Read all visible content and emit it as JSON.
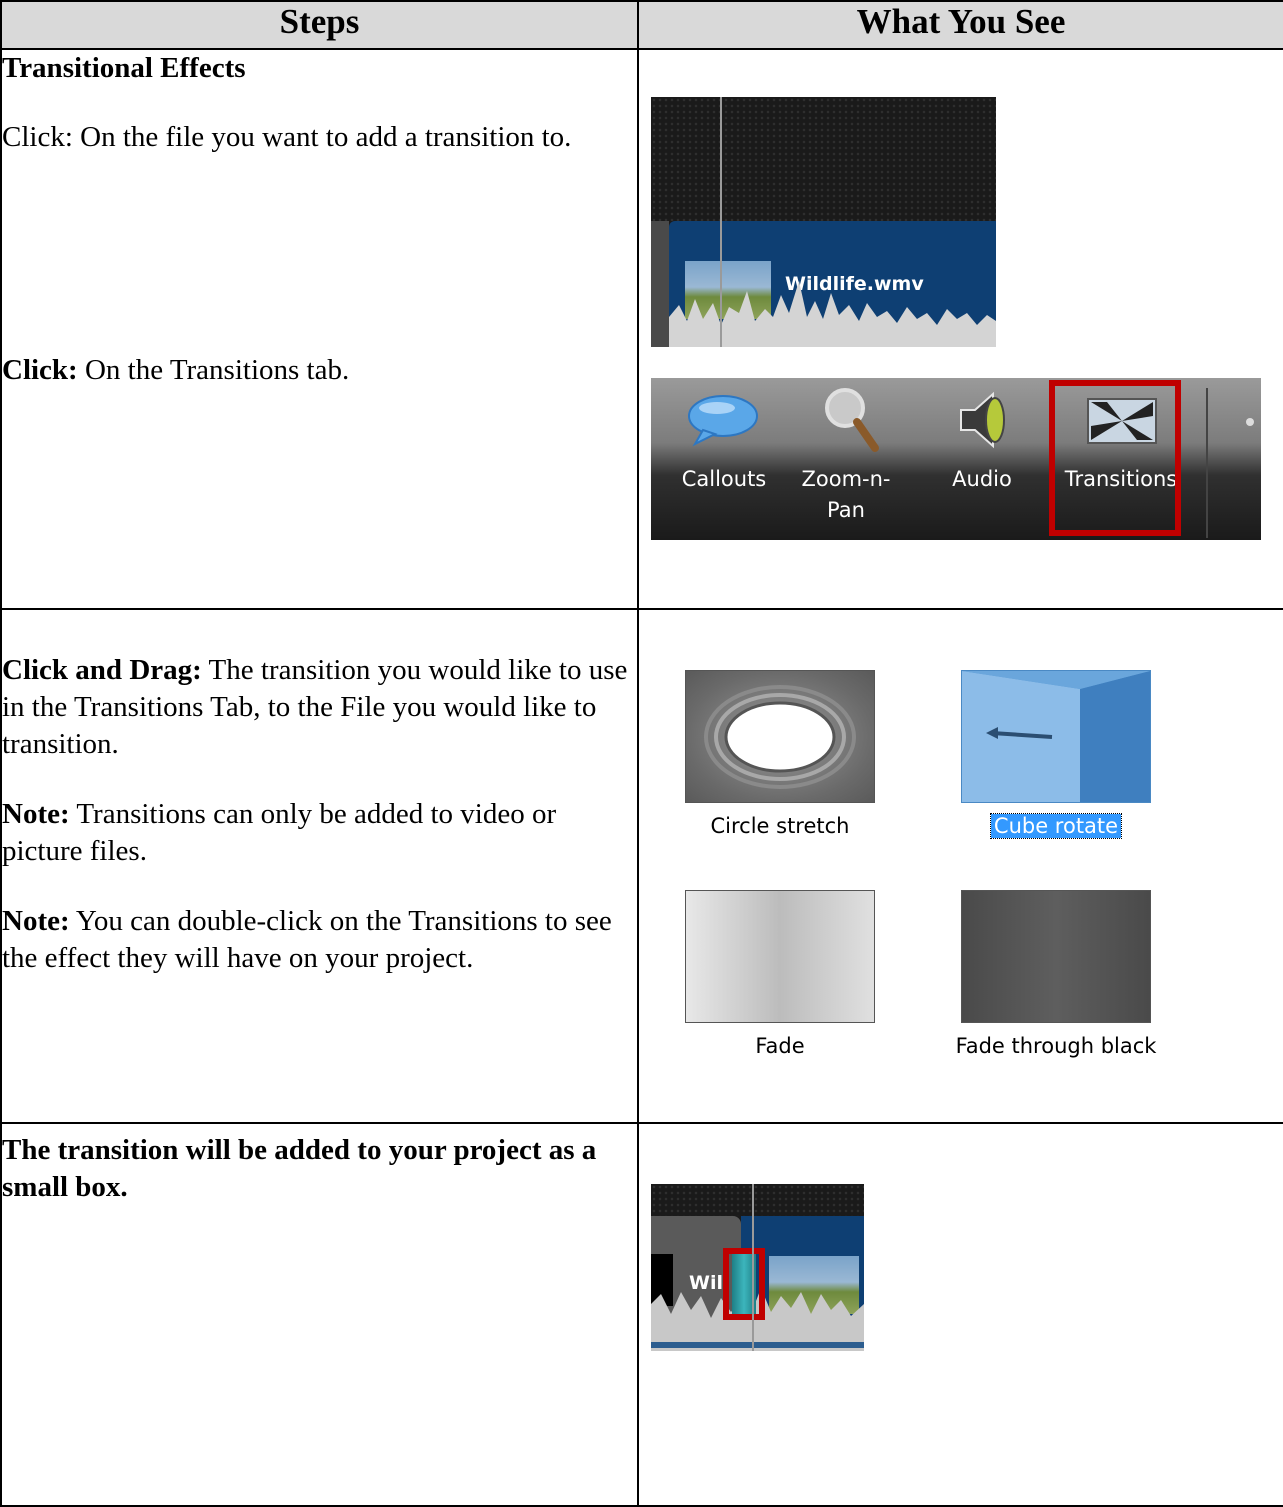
{
  "headers": {
    "steps": "Steps",
    "what_you_see": "What You See"
  },
  "row1": {
    "title": "Transitional Effects",
    "step1": {
      "prefix": "Click:",
      "text": " On the file you want to add a transition to."
    },
    "step2": {
      "prefix": "Click:",
      "text": " On the Transitions tab."
    },
    "timeline_clip_label": "Wildlife.wmv",
    "toolbar": {
      "items": [
        {
          "label": "Callouts",
          "icon": "speech-bubble-icon"
        },
        {
          "label": "Zoom-n-\nPan",
          "icon": "magnifier-icon"
        },
        {
          "label": "Audio",
          "icon": "speaker-icon"
        },
        {
          "label": "Transitions",
          "icon": "transitions-icon",
          "highlighted": true
        }
      ]
    }
  },
  "row2": {
    "step": {
      "prefix": "Click and Drag:",
      "text": " The transition you would like to use in the Transitions Tab, to the File you would like to transition."
    },
    "note1": {
      "prefix": "Note:",
      "text": " Transitions can only be added to video or picture files."
    },
    "note2": {
      "prefix": "Note:",
      "text": " You can double-click on the Transitions to see the effect they will have on your project."
    },
    "transitions": [
      {
        "label": "Circle stretch",
        "selected": false
      },
      {
        "label": "Cube rotate",
        "selected": true
      },
      {
        "label": "Fade",
        "selected": false
      },
      {
        "label": "Fade through black",
        "selected": false
      }
    ]
  },
  "row3": {
    "text": "The transition will be added to your project as a small box.",
    "clip_label": "Wil"
  },
  "colors": {
    "highlight_red": "#c00000",
    "selection_blue": "#3399ff",
    "clip_blue": "#0e3f73"
  }
}
